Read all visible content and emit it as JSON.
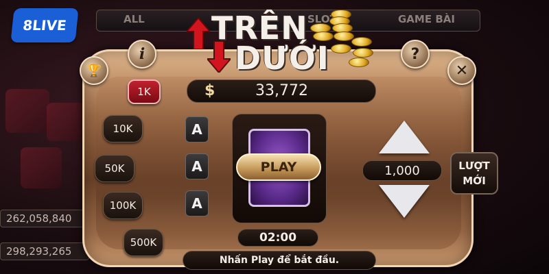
{
  "brand": "8LIVE",
  "tabs": [
    "ALL",
    "SLOT",
    "GAME BÀI"
  ],
  "title": {
    "line1": "TRÊN",
    "line2": "DƯỚI"
  },
  "icons": {
    "info": "i",
    "help": "?",
    "close": "✕",
    "trophy": "🏆"
  },
  "balance": {
    "currency_symbol": "$",
    "value": "33,772"
  },
  "bets": [
    "1K",
    "10K",
    "50K",
    "100K",
    "500K"
  ],
  "active_bet": "1K",
  "cards": [
    "A",
    "A",
    "A"
  ],
  "play_label": "PLAY",
  "timer": "02:00",
  "bet_amount": "1,000",
  "new_round": {
    "line1": "LƯỢT",
    "line2": "MỚI"
  },
  "status_text": "Nhấn Play để bắt đầu.",
  "side_balances": [
    "262,058,840",
    "298,293,265"
  ],
  "colors": {
    "accent_red": "#c0222e",
    "card_purple": "#5a2a8a",
    "gold": "#e0a820"
  }
}
